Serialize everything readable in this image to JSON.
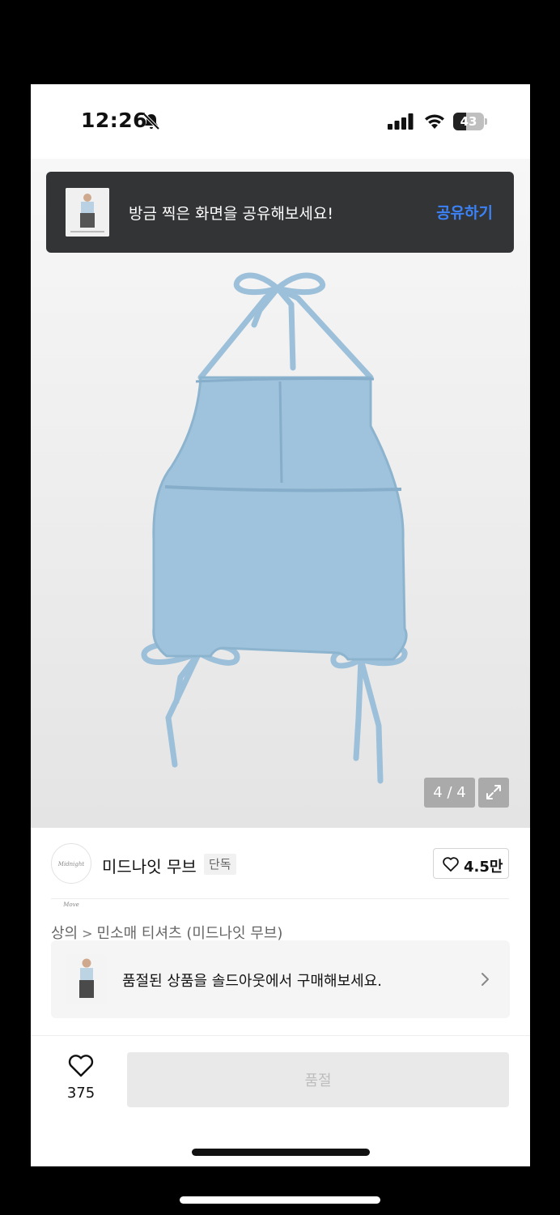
{
  "status_bar": {
    "time": "12:26",
    "battery_level": 43,
    "battery_label": "43",
    "icons": [
      "bell-slash-icon",
      "signal-icon",
      "wifi-icon",
      "battery-icon"
    ]
  },
  "toast": {
    "message": "방금 찍은 화면을 공유해보세요!",
    "action_label": "공유하기"
  },
  "gallery": {
    "counter": "4 / 4",
    "expand_icon": "expand-icon"
  },
  "brand": {
    "logo_text": "Midnight Move",
    "name": "미드나잇 무브",
    "tag": "단독",
    "like_count": "4.5만"
  },
  "breadcrumb": {
    "category": "상의",
    "separator": ">",
    "subcategory": "민소매 티셔츠 (미드나잇 무브)"
  },
  "soldout_banner": {
    "text": "품절된 상품을 솔드아웃에서 구매해보세요."
  },
  "purchase_bar": {
    "wish_count": "375",
    "button_label": "품절"
  },
  "colors": {
    "accent": "#3b82f6",
    "toast_bg": "#333436",
    "product_blue": "#9fc3dc",
    "disabled_btn": "#e9e9e9"
  }
}
